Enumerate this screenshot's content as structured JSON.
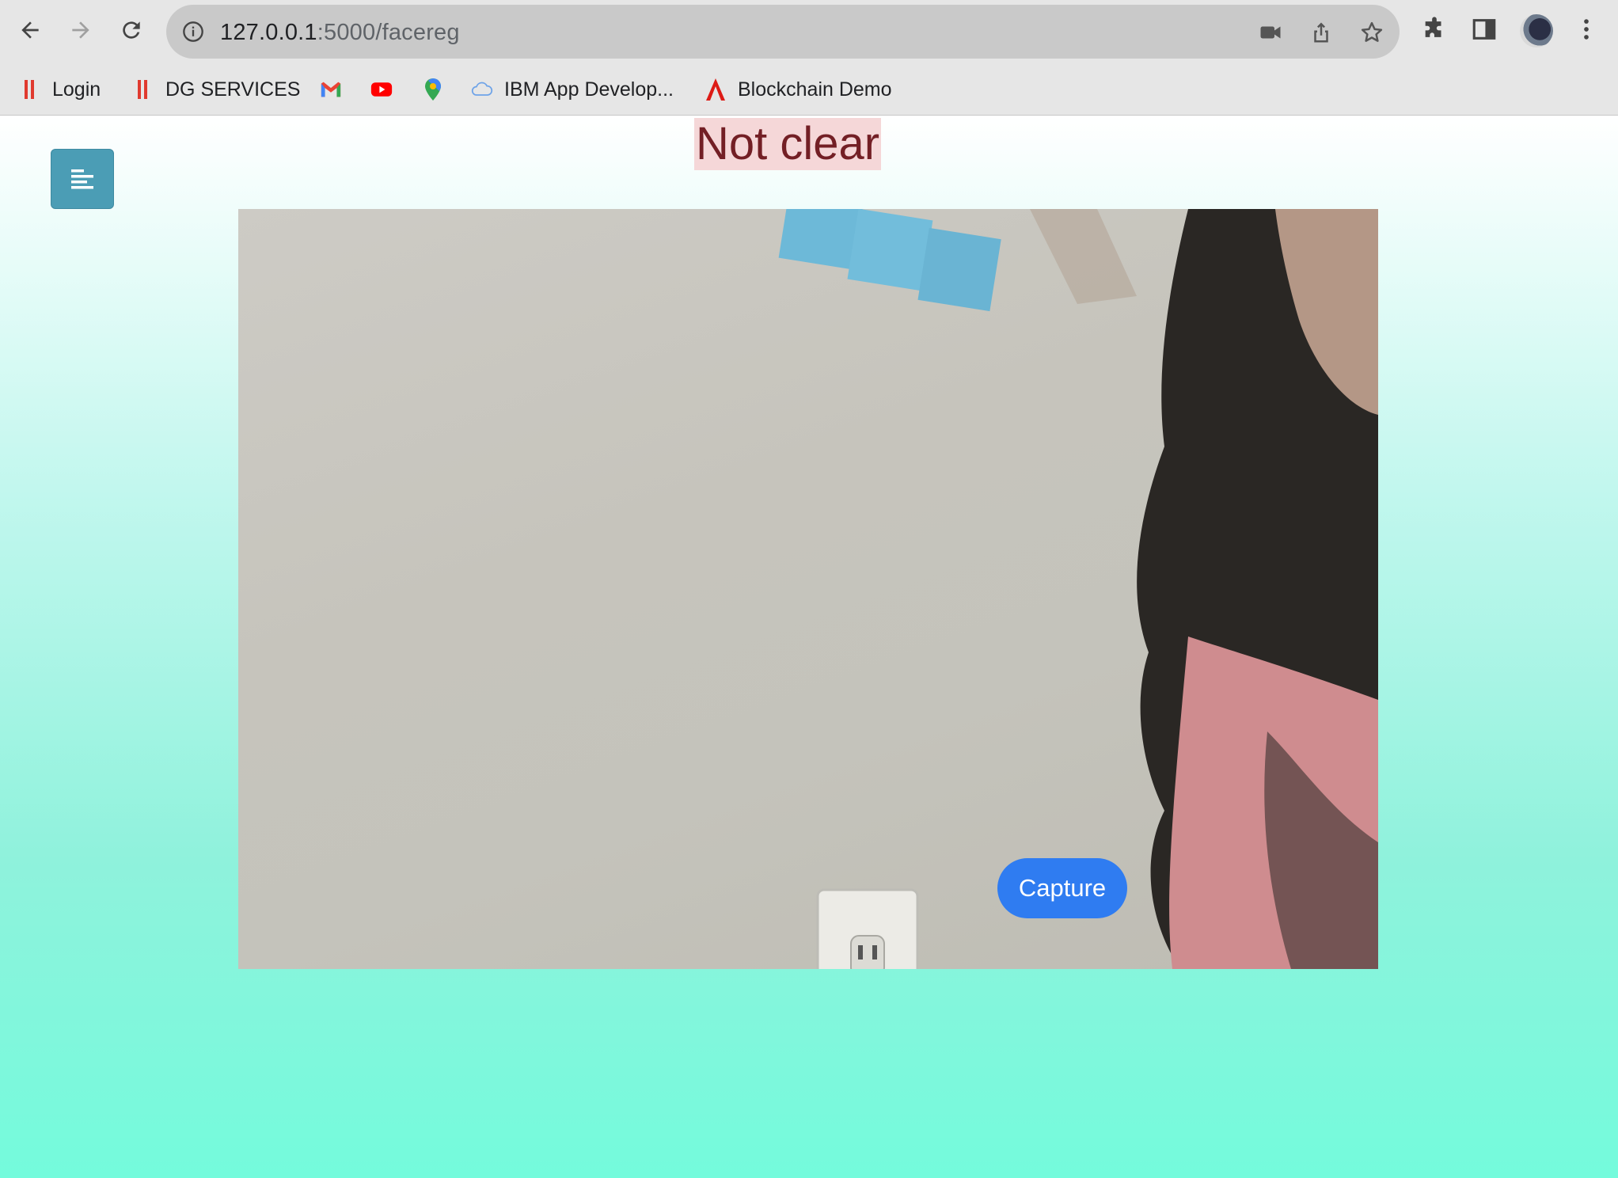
{
  "browser": {
    "url_host": "127.0.0.1",
    "url_path": ":5000/facereg",
    "bookmarks": [
      {
        "label": "Login",
        "icon": "red-bars-icon"
      },
      {
        "label": "DG SERVICES",
        "icon": "red-bars-icon"
      },
      {
        "label": "",
        "icon": "gmail-icon"
      },
      {
        "label": "",
        "icon": "youtube-icon"
      },
      {
        "label": "",
        "icon": "maps-pin-icon"
      },
      {
        "label": "IBM App Develop...",
        "icon": "cloud-icon"
      },
      {
        "label": "Blockchain Demo",
        "icon": "angular-logo-icon"
      }
    ]
  },
  "page": {
    "status_text": "Not clear",
    "capture_label": "Capture"
  },
  "colors": {
    "menu_button": "#4b9db5",
    "status_bg": "#f5d7d8",
    "status_text": "#731f25",
    "capture_button": "#2f7cf1"
  }
}
